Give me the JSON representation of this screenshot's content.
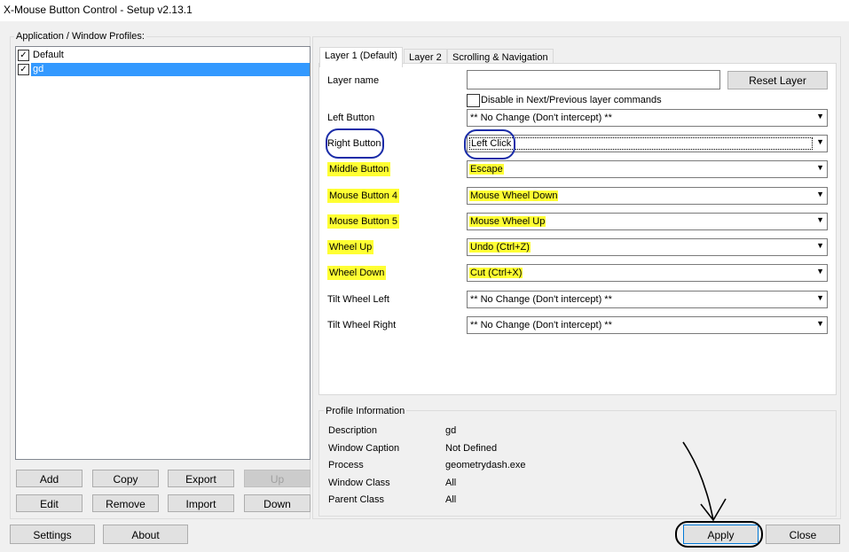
{
  "window": {
    "title": "X-Mouse Button Control - Setup v2.13.1"
  },
  "profiles": {
    "group_label": "Application / Window Profiles:",
    "items": [
      {
        "label": "Default",
        "checked": true,
        "selected": false
      },
      {
        "label": "gd",
        "checked": true,
        "selected": true
      }
    ],
    "buttons": {
      "add": "Add",
      "copy": "Copy",
      "export": "Export",
      "up": "Up",
      "edit": "Edit",
      "remove": "Remove",
      "import": "Import",
      "down": "Down"
    }
  },
  "tabs": [
    "Layer 1 (Default)",
    "Layer 2",
    "Scrolling & Navigation"
  ],
  "layer": {
    "name_label": "Layer name",
    "name_value": "",
    "reset_button": "Reset Layer",
    "disable_checkbox_label": "Disable in Next/Previous layer commands",
    "rows": [
      {
        "label": "Left Button",
        "value": "** No Change (Don't intercept) **"
      },
      {
        "label": "Right Button",
        "value": "Left Click"
      },
      {
        "label": "Middle Button",
        "value": "Escape"
      },
      {
        "label": "Mouse Button 4",
        "value": "Mouse Wheel Down"
      },
      {
        "label": "Mouse Button 5",
        "value": "Mouse Wheel Up"
      },
      {
        "label": "Wheel Up",
        "value": "Undo (Ctrl+Z)"
      },
      {
        "label": "Wheel Down",
        "value": "Cut (Ctrl+X)"
      },
      {
        "label": "Tilt Wheel Left",
        "value": "** No Change (Don't intercept) **"
      },
      {
        "label": "Tilt Wheel Right",
        "value": "** No Change (Don't intercept) **"
      }
    ]
  },
  "profile_info": {
    "group_label": "Profile Information",
    "rows": [
      {
        "label": "Description",
        "value": "gd"
      },
      {
        "label": "Window Caption",
        "value": "Not Defined"
      },
      {
        "label": "Process",
        "value": "geometrydash.exe"
      },
      {
        "label": "Window Class",
        "value": "All"
      },
      {
        "label": "Parent Class",
        "value": "All"
      }
    ]
  },
  "footer": {
    "settings": "Settings",
    "about": "About",
    "apply": "Apply",
    "close": "Close"
  },
  "colors": {
    "highlight": "#ffff33",
    "annotation": "#1a2ca8",
    "selection": "#3399ff"
  },
  "icons": {
    "dropdown": "chevron-down-icon",
    "check": "check-icon"
  }
}
